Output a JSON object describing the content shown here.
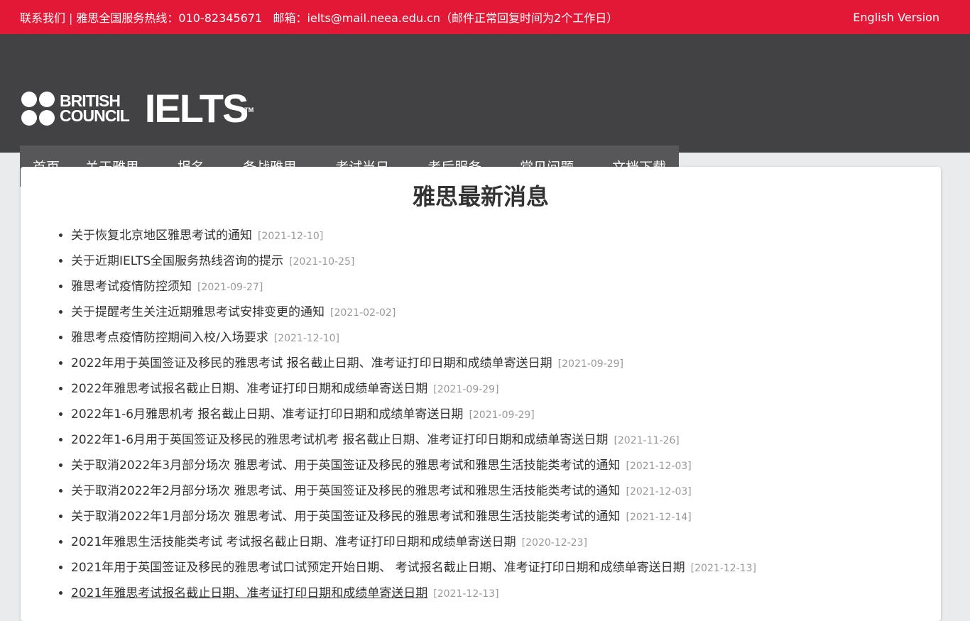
{
  "topbar": {
    "contact_label": "联系我们",
    "divider": "|",
    "hotline": "雅思全国服务热线：010-82345671",
    "email": "邮箱：ielts@mail.neea.edu.cn（邮件正常回复时间为2个工作日）",
    "english_link": "English Version",
    "bg_color": "#e31837"
  },
  "header": {
    "bc_line1": "BRITISH",
    "bc_line2": "COUNCIL",
    "ielts": "IELTS",
    "tm": "TM",
    "bg_color": "#424244"
  },
  "nav": {
    "items": [
      {
        "label": "首页",
        "dropdown": false
      },
      {
        "label": "关于雅思",
        "dropdown": true
      },
      {
        "label": "报名",
        "dropdown": true
      },
      {
        "label": "备战雅思",
        "dropdown": true
      },
      {
        "label": "考试当日",
        "dropdown": true
      },
      {
        "label": "考后服务",
        "dropdown": true
      },
      {
        "label": "常见问题",
        "dropdown": true
      },
      {
        "label": "文档下载",
        "dropdown": false
      }
    ]
  },
  "main": {
    "title": "雅思最新消息",
    "news": [
      {
        "title": "关于恢复北京地区雅思考试的通知",
        "date": "[2021-12-10]"
      },
      {
        "title": "关于近期IELTS全国服务热线咨询的提示",
        "date": "[2021-10-25]"
      },
      {
        "title": "雅思考试疫情防控须知",
        "date": "[2021-09-27]"
      },
      {
        "title": "关于提醒考生关注近期雅思考试安排变更的通知",
        "date": "[2021-02-02]"
      },
      {
        "title": "雅思考点疫情防控期间入校/入场要求",
        "date": "[2021-12-10]"
      },
      {
        "title": "2022年用于英国签证及移民的雅思考试 报名截止日期、准考证打印日期和成绩单寄送日期",
        "date": "[2021-09-29]"
      },
      {
        "title": "2022年雅思考试报名截止日期、准考证打印日期和成绩单寄送日期",
        "date": "[2021-09-29]"
      },
      {
        "title": "2022年1-6月雅思机考 报名截止日期、准考证打印日期和成绩单寄送日期",
        "date": "[2021-09-29]"
      },
      {
        "title": "2022年1-6月用于英国签证及移民的雅思考试机考 报名截止日期、准考证打印日期和成绩单寄送日期",
        "date": "[2021-11-26]"
      },
      {
        "title": "关于取消2022年3月部分场次 雅思考试、用于英国签证及移民的雅思考试和雅思生活技能类考试的通知",
        "date": "[2021-12-03]"
      },
      {
        "title": "关于取消2022年2月部分场次 雅思考试、用于英国签证及移民的雅思考试和雅思生活技能类考试的通知",
        "date": "[2021-12-03]"
      },
      {
        "title": "关于取消2022年1月部分场次 雅思考试、用于英国签证及移民的雅思考试和雅思生活技能类考试的通知",
        "date": "[2021-12-14]"
      },
      {
        "title": "2021年雅思生活技能类考试 考试报名截止日期、准考证打印日期和成绩单寄送日期",
        "date": "[2020-12-23]"
      },
      {
        "title": "2021年用于英国签证及移民的雅思考试口试预定开始日期、 考试报名截止日期、准考证打印日期和成绩单寄送日期",
        "date": "[2021-12-13]"
      },
      {
        "title": "2021年雅思考试报名截止日期、准考证打印日期和成绩单寄送日期",
        "date": "[2021-12-13]"
      }
    ]
  }
}
